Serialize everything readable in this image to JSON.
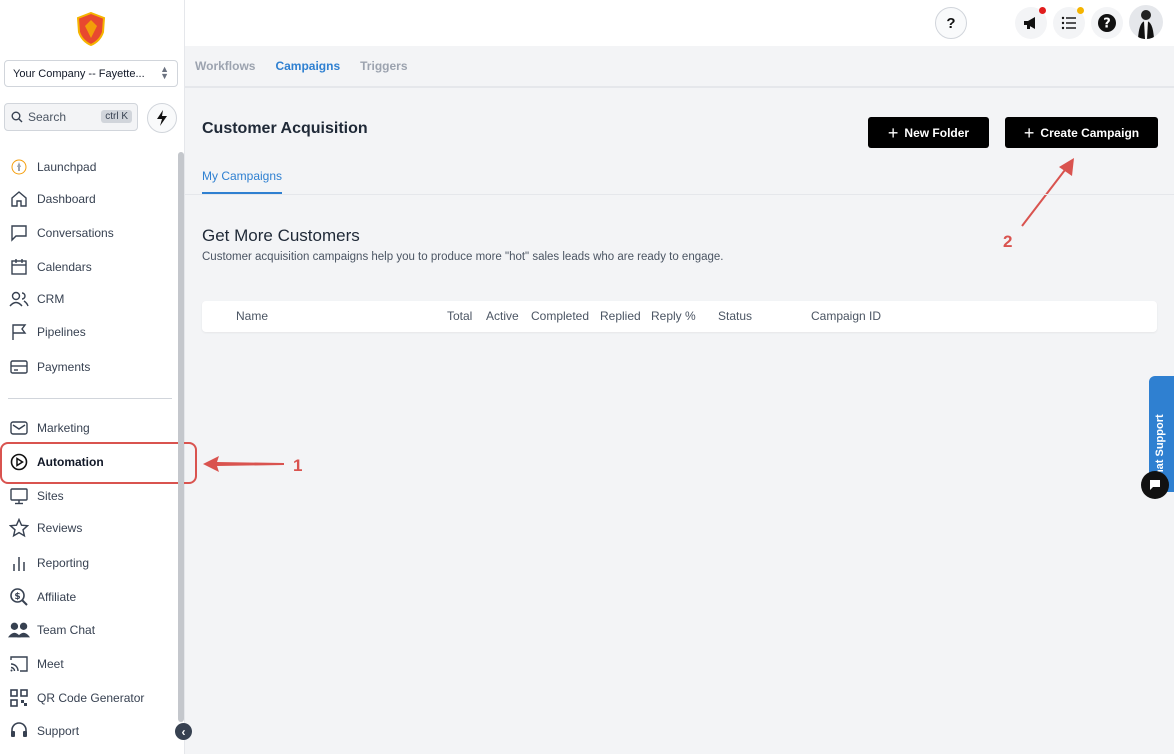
{
  "sidebar": {
    "company": "Your Company -- Fayette...",
    "search_placeholder": "Search",
    "search_shortcut": "ctrl K",
    "items": [
      {
        "label": "Launchpad",
        "icon": "launchpad-icon"
      },
      {
        "label": "Dashboard",
        "icon": "home-icon"
      },
      {
        "label": "Conversations",
        "icon": "chat-icon"
      },
      {
        "label": "Calendars",
        "icon": "calendar-icon"
      },
      {
        "label": "CRM",
        "icon": "users-icon"
      },
      {
        "label": "Pipelines",
        "icon": "flag-icon"
      },
      {
        "label": "Payments",
        "icon": "card-icon"
      },
      {
        "label": "Marketing",
        "icon": "mail-icon"
      },
      {
        "label": "Automation",
        "icon": "play-circle-icon"
      },
      {
        "label": "Sites",
        "icon": "monitor-icon"
      },
      {
        "label": "Reviews",
        "icon": "star-icon"
      },
      {
        "label": "Reporting",
        "icon": "bar-chart-icon"
      },
      {
        "label": "Affiliate",
        "icon": "dollar-search-icon"
      },
      {
        "label": "Team Chat",
        "icon": "team-icon"
      },
      {
        "label": "Meet",
        "icon": "cast-icon"
      },
      {
        "label": "QR Code Generator",
        "icon": "qr-icon"
      },
      {
        "label": "Support",
        "icon": "headset-icon"
      }
    ]
  },
  "subnav": {
    "workflows": "Workflows",
    "campaigns": "Campaigns",
    "triggers": "Triggers"
  },
  "main": {
    "title": "Customer Acquisition",
    "new_folder": "New Folder",
    "create_campaign": "Create Campaign",
    "tab": "My Campaigns",
    "section_title": "Get More Customers",
    "section_desc": "Customer acquisition campaigns help you to produce more \"hot\" sales leads who are ready to engage.",
    "columns": [
      "Name",
      "Total",
      "Active",
      "Completed",
      "Replied",
      "Reply %",
      "Status",
      "Campaign ID"
    ]
  },
  "annotations": {
    "one": "1",
    "two": "2"
  },
  "chat_support": "Chat Support",
  "colors": {
    "accent": "#2f80d1",
    "annotation": "#d9534f",
    "primary_button": "#000000"
  }
}
